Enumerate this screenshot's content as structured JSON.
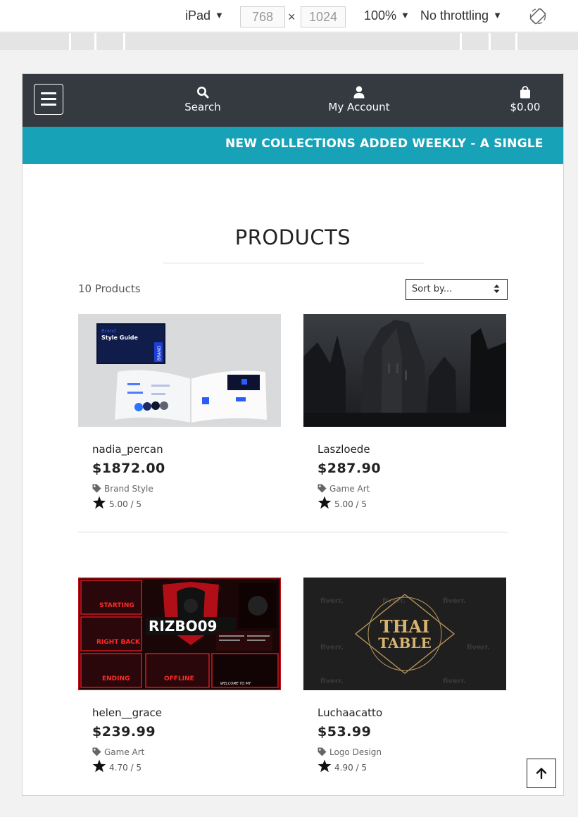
{
  "devtools": {
    "device": "iPad",
    "width": "768",
    "height": "1024",
    "times": "×",
    "zoom": "100%",
    "throttle": "No throttling",
    "icons": [
      "dropdown-arrow",
      "rotate-icon"
    ]
  },
  "navbar": {
    "search_label": "Search",
    "account_label": "My Account",
    "cart_total": "$0.00",
    "icons": [
      "menu-icon",
      "search-icon",
      "user-icon",
      "shopping-bag-icon"
    ]
  },
  "banner": {
    "text": "NEW COLLECTIONS ADDED WEEKLY - A SINGLE PLACE"
  },
  "products": {
    "title": "PRODUCTS",
    "count_label": "10 Products",
    "sort_placeholder": "Sort by...",
    "items": [
      {
        "seller": "nadia_percan",
        "price": "$1872.00",
        "category": "Brand Style",
        "rating": "5.00 / 5",
        "image": "brand-style-guide-mockup"
      },
      {
        "seller": "Laszloede",
        "price": "$287.90",
        "category": "Game Art",
        "rating": "5.00 / 5",
        "image": "dark-ruined-city-artwork"
      },
      {
        "seller": "helen__grace",
        "price": "$239.99",
        "category": "Game Art",
        "rating": "4.70 / 5",
        "image": "red-stream-overlay-pack"
      },
      {
        "seller": "Luchaacatto",
        "price": "$53.99",
        "category": "Logo Design",
        "rating": "4.90 / 5",
        "image": "thai-table-gold-logo"
      }
    ],
    "image_text": {
      "brand_line1": "Brand",
      "brand_line2": "Style Guide",
      "brand_side": "BRAND",
      "stream_logo": "RIZBO09",
      "stream_tags": [
        "STARTING",
        "RIGHT BACK",
        "ENDING",
        "OFFLINE",
        "WELCOME TO MY"
      ],
      "thai_line1": "THAI",
      "thai_line2": "TABLE",
      "watermark": "fiverr."
    }
  },
  "colors": {
    "navbar": "#343a40",
    "banner": "#17a2b8",
    "text": "#222222"
  },
  "ui": {
    "back_to_top_icon": "arrow-up-icon"
  }
}
